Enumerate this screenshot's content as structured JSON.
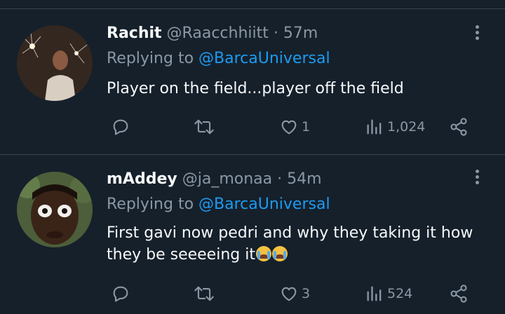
{
  "tweets": [
    {
      "display_name": "Rachit",
      "handle": "@Raacchhiitt",
      "separator": "·",
      "time": "57m",
      "replying_prefix": "Replying to",
      "replying_handle": "@BarcaUniversal",
      "text": "Player on the field...player off the field",
      "likes": "1",
      "views": "1,024"
    },
    {
      "display_name": "mAddey",
      "handle": "@ja_monaa",
      "separator": "·",
      "time": "54m",
      "replying_prefix": "Replying to",
      "replying_handle": "@BarcaUniversal",
      "text_line1": "First gavi now pedri and why they taking it how",
      "text_line2": "they be seeeeing it",
      "emojis": [
        "loudly-crying-face",
        "loudly-crying-face"
      ],
      "likes": "3",
      "views": "524"
    }
  ],
  "colors": {
    "background": "#15202b",
    "divider": "#38444d",
    "text": "#f7f9f9",
    "muted": "#8b98a5",
    "link": "#1d9bf0"
  },
  "icons": [
    "reply-icon",
    "retweet-icon",
    "like-icon",
    "views-icon",
    "share-icon",
    "more-icon"
  ]
}
